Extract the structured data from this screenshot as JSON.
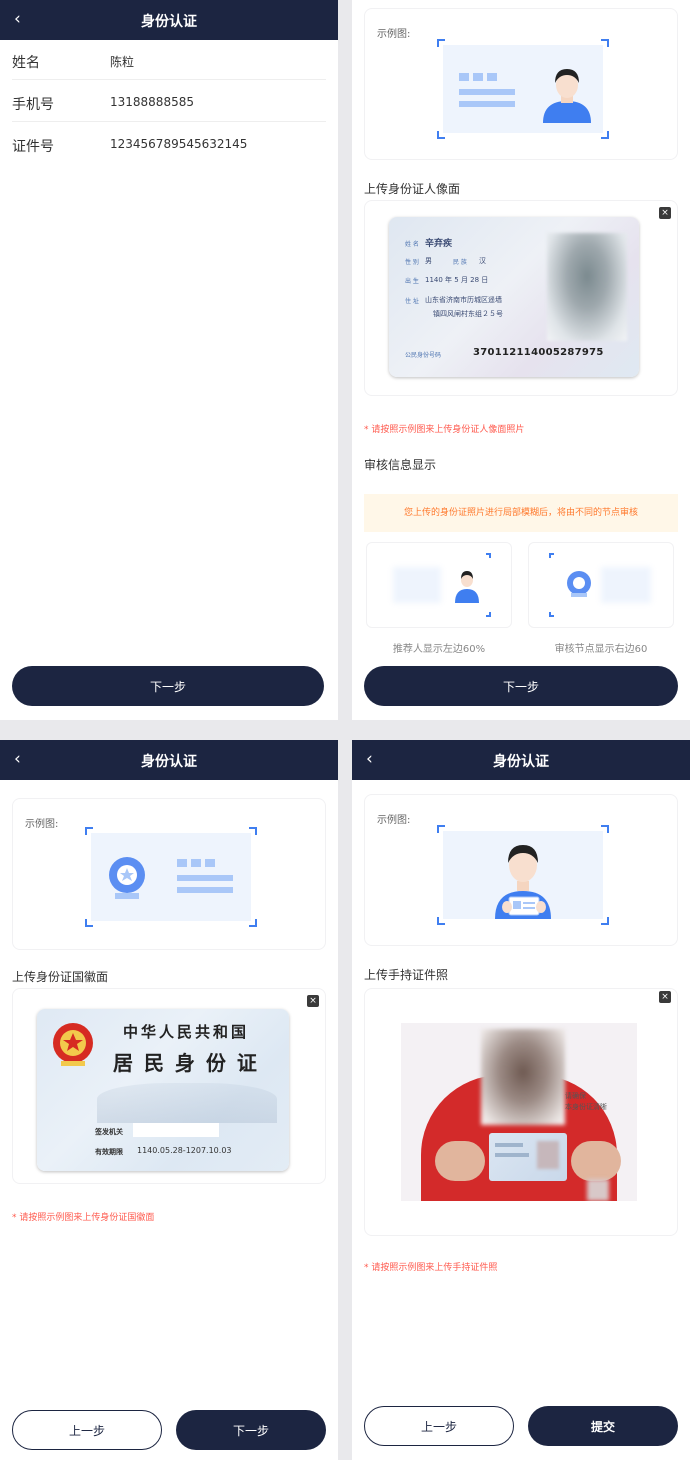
{
  "nav": {
    "back_icon": "‹",
    "title": "身份认证"
  },
  "screen1": {
    "rows": [
      {
        "label": "姓名",
        "value": "陈粒"
      },
      {
        "label": "手机号",
        "value": "13188888585"
      },
      {
        "label": "证件号",
        "value": "123456789545632145"
      }
    ],
    "next_button": "下一步"
  },
  "screen2": {
    "sample_label": "示例图:",
    "upload_title": "上传身份证人像面",
    "hint": "* 请按照示例图来上传身份证人像面照片",
    "close_icon": "×",
    "id_card": {
      "name_label": "姓 名",
      "name": "辛弃疾",
      "gender_label": "性 别",
      "gender": "男",
      "ethnicity_label": "民 族",
      "ethnicity": "汉",
      "birth_label": "出 生",
      "birth": "1140  年  5  月 28 日",
      "address_label": "住 址",
      "address_line1": "山东省济南市历城区遥墙",
      "address_line2": "镇四风闸村东组２５号",
      "number_label": "公民身份号码",
      "number": "370112114005287975"
    },
    "review_title": "审核信息显示",
    "notice": "您上传的身份证照片进行局部模糊后，将由不同的节点审核",
    "left_caption": "推荐人显示左边60%",
    "right_caption": "审核节点显示右边60",
    "next_button": "下一步"
  },
  "screen3": {
    "sample_label": "示例图:",
    "upload_title": "上传身份证国徽面",
    "hint": "* 请按照示例图来上传身份证国徽面",
    "close_icon": "×",
    "id_back": {
      "country": "中华人民共和国",
      "card_name": "居 民 身 份 证",
      "authority_label": "签发机关",
      "validity_label": "有效期限",
      "validity": "1140.05.28-1207.10.03"
    },
    "prev_button": "上一步",
    "next_button": "下一步"
  },
  "screen4": {
    "sample_label": "示例图:",
    "upload_title": "上传手持证件照",
    "hint": "* 请按照示例图来上传手持证件照",
    "close_icon": "×",
    "handwritten_note": "请确保\n本身份证清晰",
    "prev_button": "上一步",
    "submit_button": "提交"
  },
  "colors": {
    "nav_bg": "#1c2541",
    "accent_blue": "#3f7ef0",
    "hint_red": "#ff5a4e",
    "notice_orange": "#ff7a2e"
  }
}
